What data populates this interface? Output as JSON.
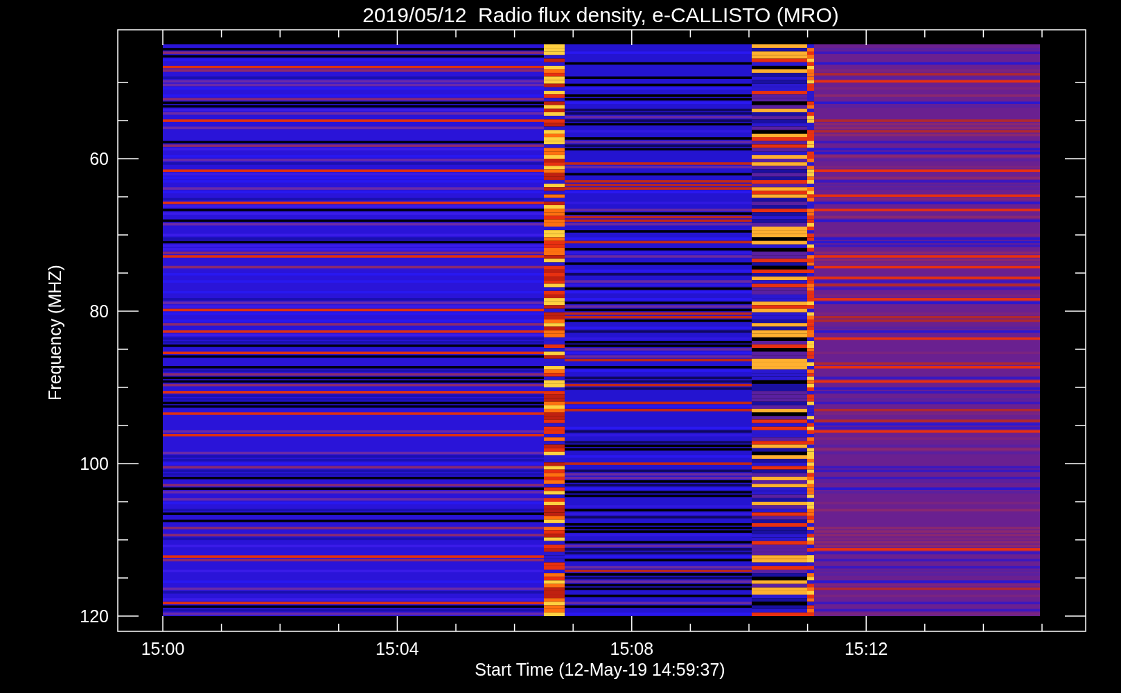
{
  "title": "2019/05/12  Radio flux density, e-CALLISTO (MRO)",
  "y_axis": {
    "label": "Frequency (MHZ)",
    "ticks": [
      "60",
      "80",
      "100",
      "120"
    ]
  },
  "x_axis": {
    "label": "Start Time (12-May-19 14:59:37)",
    "ticks": [
      "15:00",
      "15:04",
      "15:08",
      "15:12"
    ]
  }
}
